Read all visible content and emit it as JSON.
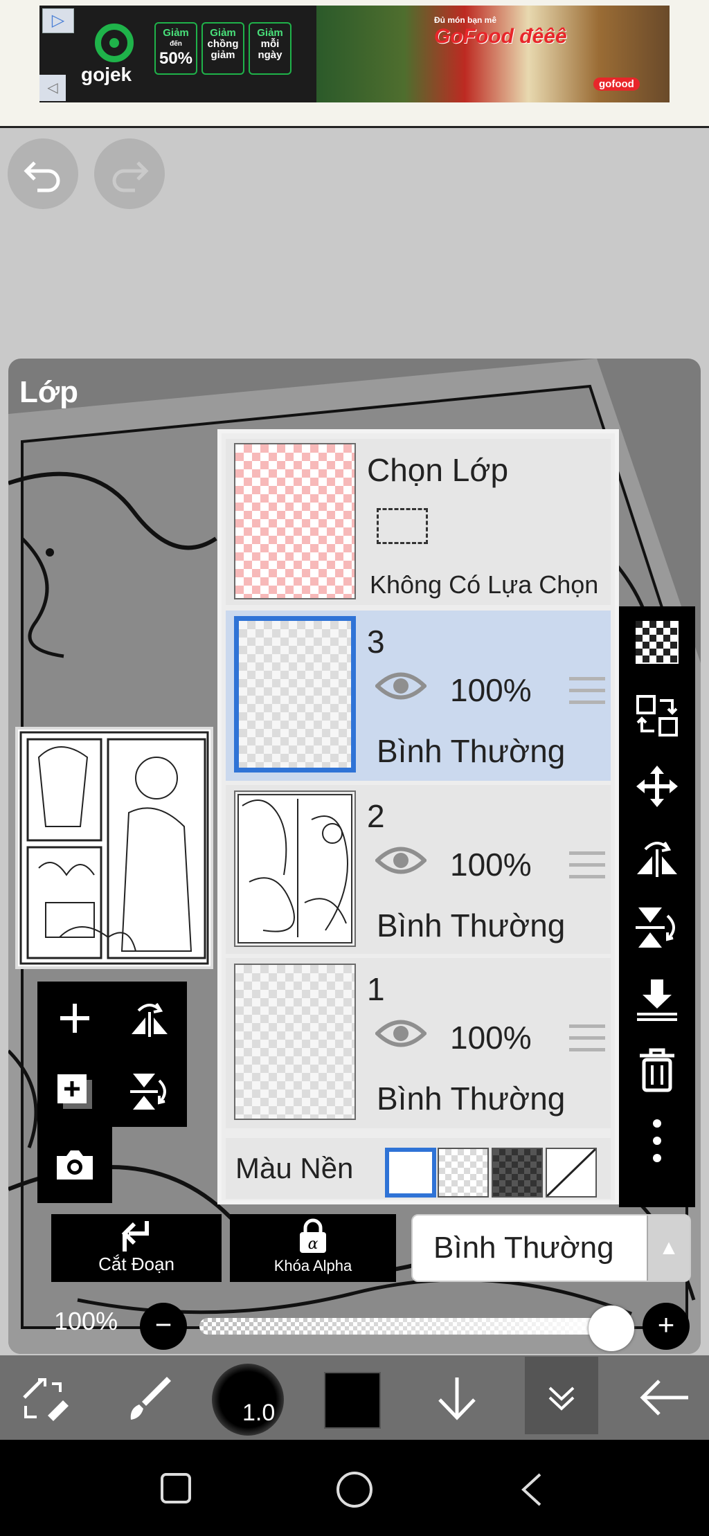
{
  "ad": {
    "brand": "gojek",
    "badges": [
      {
        "line1": "Giảm",
        "line2": "đến",
        "line3": "50%"
      },
      {
        "line1": "Giảm",
        "line2": "chồng",
        "line3": "giảm"
      },
      {
        "line1": "Giảm",
        "line2": "mỗi",
        "line3": "ngày"
      }
    ],
    "headline": "Đủ món bạn mê",
    "promo": "GoFood đêêê",
    "tag": "gofood"
  },
  "panel": {
    "title": "Lớp"
  },
  "selection_layer": {
    "title": "Chọn Lớp",
    "status": "Không Có Lựa Chọn"
  },
  "layers": [
    {
      "number": "3",
      "opacity": "100%",
      "mode": "Bình Thường",
      "selected": true
    },
    {
      "number": "2",
      "opacity": "100%",
      "mode": "Bình Thường",
      "selected": false
    },
    {
      "number": "1",
      "opacity": "100%",
      "mode": "Bình Thường",
      "selected": false
    }
  ],
  "background": {
    "label": "Màu Nền"
  },
  "actions": {
    "clip_label": "Cắt Đoạn",
    "alpha_label": "Khóa Alpha",
    "blend_mode": "Bình Thường"
  },
  "opacity": {
    "label": "100%",
    "value": 1.0
  },
  "toolbar": {
    "brush_size": "1.0",
    "color": "#000000"
  },
  "icons": {
    "undo": "undo-icon",
    "redo": "redo-icon",
    "visibility": "eye-icon",
    "drag": "drag-handle-icon",
    "transparent": "checkerboard-icon",
    "swap": "move-layer-icon",
    "move": "move-arrows-icon",
    "flip_h": "flip-horizontal-icon",
    "flip_v": "flip-vertical-icon",
    "merge_down": "merge-down-icon",
    "delete": "trash-icon",
    "more": "more-vertical-icon"
  }
}
